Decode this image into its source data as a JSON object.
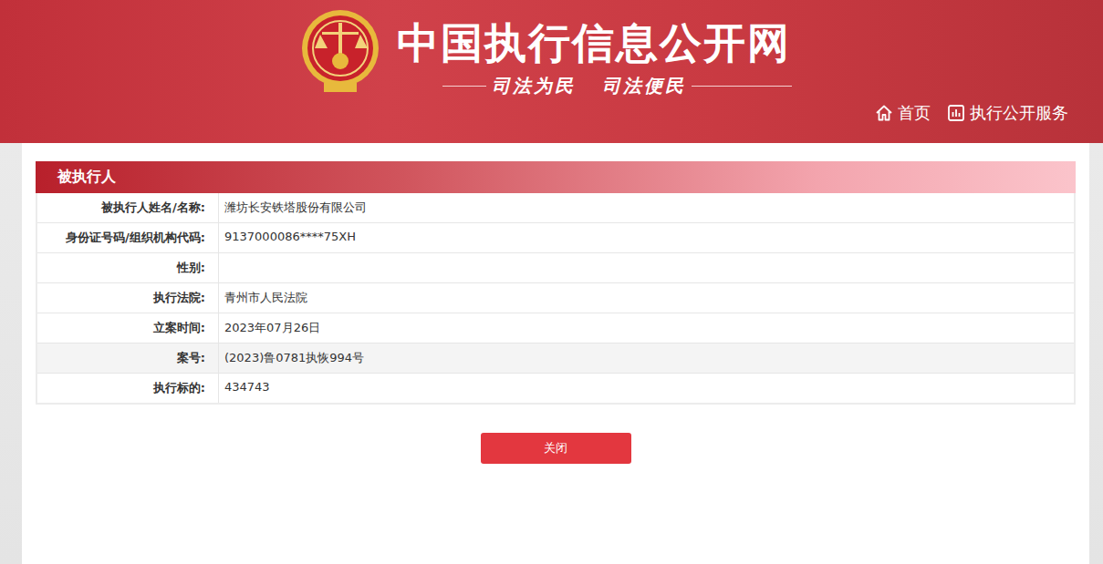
{
  "header": {
    "title": "中国执行信息公开网",
    "slogan": "司法为民   司法便民",
    "nav": [
      {
        "label": "首页",
        "icon": "home"
      },
      {
        "label": "执行公开服务",
        "icon": "chart"
      }
    ]
  },
  "section": {
    "title": "被执行人"
  },
  "rows": [
    {
      "label": "被执行人姓名/名称:",
      "value": "潍坊长安铁塔股份有限公司",
      "highlighted": false
    },
    {
      "label": "身份证号码/组织机构代码:",
      "value": "9137000086****75XH",
      "highlighted": false
    },
    {
      "label": "性别:",
      "value": "",
      "highlighted": false
    },
    {
      "label": "执行法院:",
      "value": "青州市人民法院",
      "highlighted": false
    },
    {
      "label": "立案时间:",
      "value": "2023年07月26日",
      "highlighted": false
    },
    {
      "label": "案号:",
      "value": "(2023)鲁0781执恢994号",
      "highlighted": true
    },
    {
      "label": "执行标的:",
      "value": "434743",
      "highlighted": false
    }
  ],
  "button": {
    "label": "关闭"
  }
}
